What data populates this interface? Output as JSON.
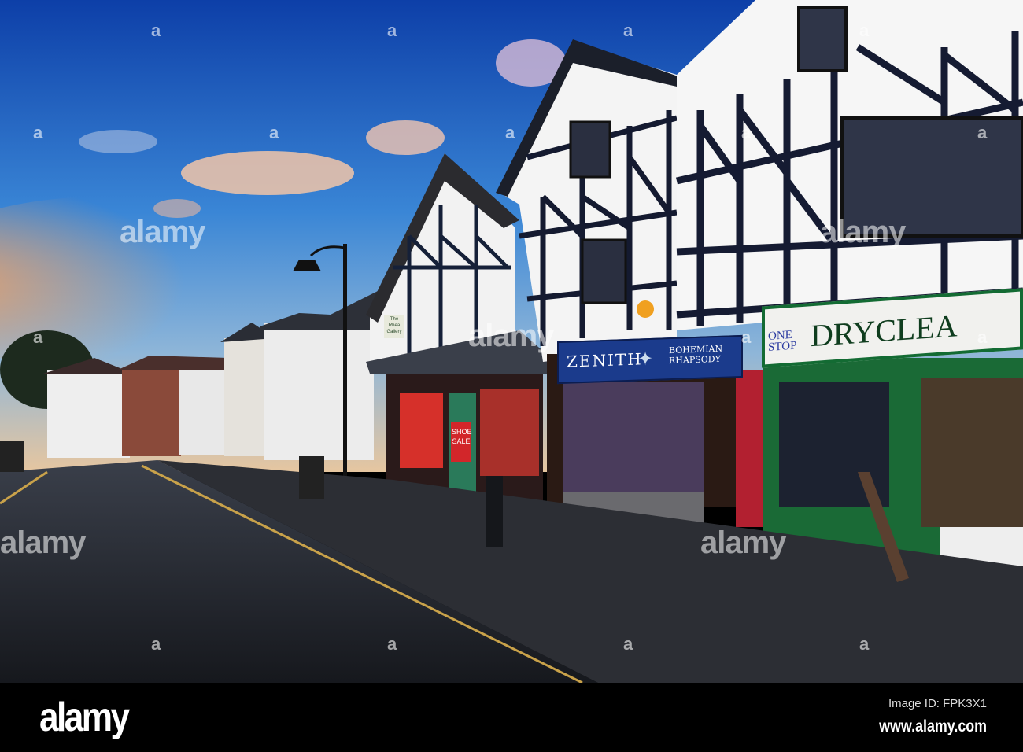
{
  "watermark": {
    "brand": "alamy",
    "letter": "a"
  },
  "signs": {
    "zenith": "ZENITH",
    "bohemian": "BOHEMIAN RHAPSODY",
    "one_stop": "ONE STOP",
    "dryclean": "DRYCLEA",
    "shoe_sale": "SHOE SALE",
    "gallery": "The Rhea Gallery"
  },
  "footer": {
    "logo": "alamy",
    "image_id": "Image ID: FPK3X1",
    "url": "www.alamy.com"
  },
  "colors": {
    "sky_top": "#0d3fa8",
    "sky_mid": "#3a86d6",
    "cloud_glow": "#f3b07a",
    "timber": "#151c33",
    "sign_blue": "#1b3b8c",
    "sign_green": "#136b33"
  }
}
